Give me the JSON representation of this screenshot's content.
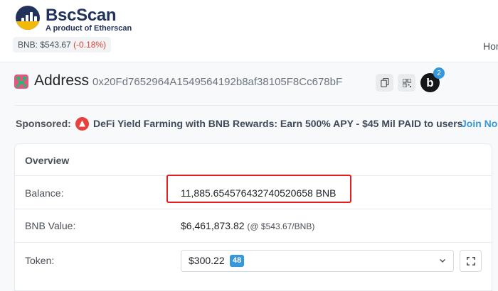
{
  "brand": {
    "name": "BscScan",
    "tagline": "A product of Etherscan"
  },
  "price": {
    "label": "BNB: $543.67",
    "change": "(-0.18%)"
  },
  "nav": {
    "home_label": "Hom"
  },
  "address": {
    "title": "Address",
    "hash": "0x20Fd7652964A1549564192b8af38105F8Cc678bF",
    "badge_letter": "b",
    "badge_count": "2"
  },
  "sponsored": {
    "label": "Sponsored:",
    "text": "DeFi Yield Farming with BNB Rewards: Earn 500% APY - $45 Mil PAID to users.",
    "link": "Join No"
  },
  "overview": {
    "title": "Overview",
    "balance_label": "Balance:",
    "balance_value": "11,885.654576432740520658 BNB",
    "bnb_value_label": "BNB Value:",
    "bnb_value": "$6,461,873.82",
    "bnb_value_rate": "(@ $543.67/BNB)",
    "token_label": "Token:",
    "token_value": "$300.22",
    "token_count": "48"
  },
  "colors": {
    "brand": "#21325b",
    "accent": "#3498db",
    "negative": "#de4437",
    "highlight": "#e02020",
    "bnb_yellow": "#f0b90b"
  },
  "icons": {
    "copy": "copy-icon",
    "qr": "qr-code-icon",
    "chevron": "chevron-down-icon",
    "expand": "expand-icon"
  }
}
